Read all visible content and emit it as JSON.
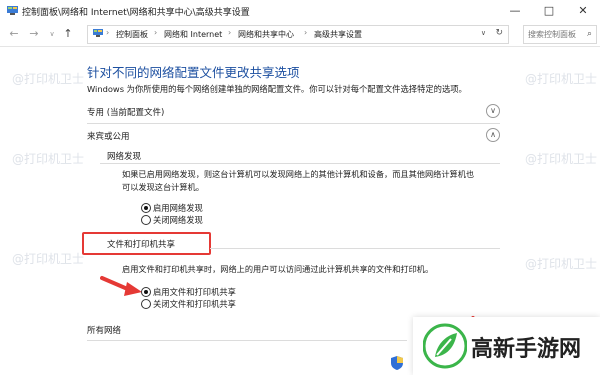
{
  "window": {
    "title": "控制面板\\网络和 Internet\\网络和共享中心\\高级共享设置",
    "minimize": "—",
    "maximize": "□",
    "close": "✕"
  },
  "address": {
    "crumbs": [
      "控制面板",
      "网络和 Internet",
      "网络和共享中心",
      "高级共享设置"
    ],
    "separator": "›",
    "search_placeholder": "搜索控制面板"
  },
  "main": {
    "heading": "针对不同的网络配置文件更改共享选项",
    "description": "Windows 为你所使用的每个网络创建单独的网络配置文件。你可以针对每个配置文件选择特定的选项。",
    "profiles": {
      "private_label": "专用 (当前配置文件)",
      "guest_label": "来宾或公用",
      "all_label": "所有网络"
    },
    "discovery": {
      "title": "网络发现",
      "text_line1": "如果已启用网络发现，则这台计算机可以发现网络上的其他计算机和设备，而且其他网络计算机也",
      "text_line2": "可以发现这台计算机。",
      "option_on": "启用网络发现",
      "option_off": "关闭网络发现"
    },
    "sharing": {
      "title": "文件和打印机共享",
      "text": "启用文件和打印机共享时，网络上的用户可以访问通过此计算机共享的文件和打印机。",
      "option_on": "启用文件和打印机共享",
      "option_off": "关闭文件和打印机共享"
    }
  },
  "watermark": "@打印机卫士",
  "badge": {
    "text": "高新手游网"
  },
  "colors": {
    "heading": "#1c4fa0",
    "highlight": "#e53935",
    "badge_green": "#3bb54a"
  }
}
